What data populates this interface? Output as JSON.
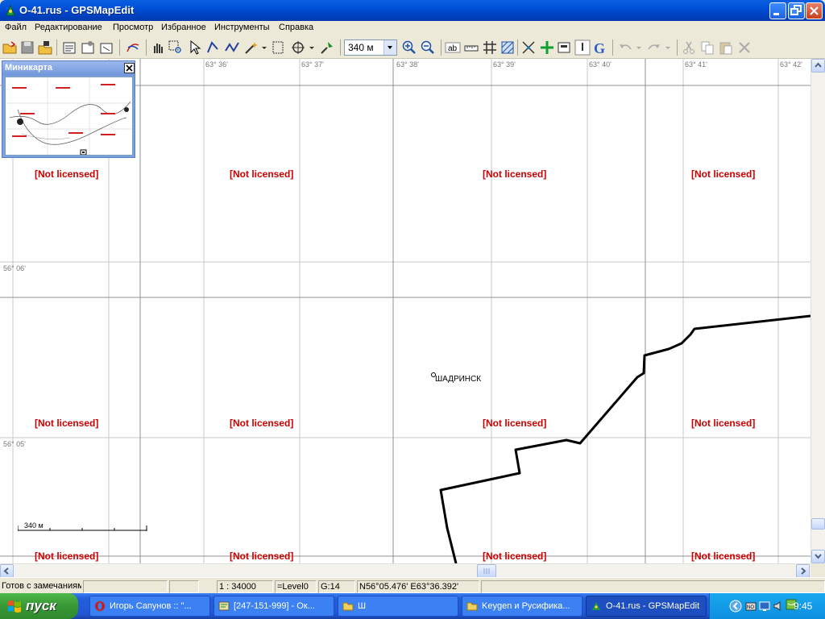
{
  "window": {
    "title": "O-41.rus - GPSMapEdit"
  },
  "menu": [
    "Файл",
    "Редактирование",
    "Просмотр",
    "Избранное",
    "Инструменты",
    "Справка"
  ],
  "toolbar": {
    "scale_value": "340 м"
  },
  "minimap": {
    "title": "Миникарта"
  },
  "map": {
    "longitude_labels": [
      "63° 36'",
      "63° 37'",
      "63° 38'",
      "63° 39'",
      "63° 40'",
      "63° 41'",
      "63° 42'"
    ],
    "latitude_labels": [
      "56° 06'",
      "56° 05'"
    ],
    "watermark": "[Not licensed]",
    "city_label": "ШАДРИНСК",
    "scale_bar_label": "340 м"
  },
  "status": {
    "message": "Готов с замечаниям",
    "scale": "1 : 34000",
    "level": "=Level0",
    "grid": "G:14",
    "coordinates": "N56°05.476' E63°36.392'"
  },
  "taskbar": {
    "start_label": "пуск",
    "tasks": [
      "Игорь Сапунов :: \"...",
      "[247-151-999] - Ок...",
      "Ш",
      "Keygen и Русифика...",
      "O-41.rus - GPSMapEdit"
    ],
    "language": "EN",
    "clock": "9:45"
  },
  "colors": {
    "watermark": "#cc0000",
    "titlebar": "#0050d8",
    "taskbar": "#245edb",
    "start": "#389735"
  }
}
